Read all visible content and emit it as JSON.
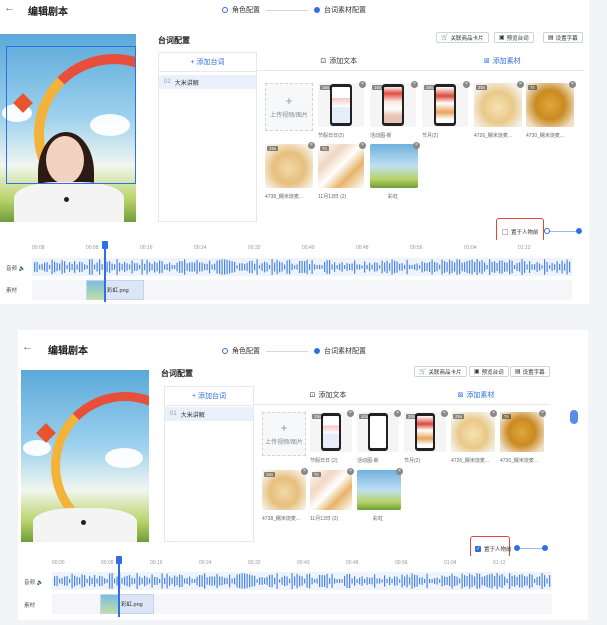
{
  "shot1": {
    "back_icon": "←",
    "title": "编辑剧本",
    "steps": [
      "角色配置",
      "台词素材配置"
    ],
    "panel_title": "台词配置",
    "toolbar": {
      "btn_card": "关联商品卡片",
      "btn_preview": "预览台词",
      "btn_subtitle": "设置字幕"
    },
    "sidebar": {
      "add_label": "+ 添加台词",
      "item_index": "01",
      "item_label": "大米讲解"
    },
    "tabs": {
      "text": "添加文本",
      "material": "添加素材"
    },
    "upload_label": "上传视频/图片",
    "assets_row1": [
      {
        "badge": "15s",
        "cap": "节假日日(2)"
      },
      {
        "badge": "10s",
        "cap": "活动图-新"
      },
      {
        "badge": "20s",
        "cap": "节月(2)"
      },
      {
        "badge": "25s",
        "cap": "4726_糯米烧麦..."
      },
      {
        "badge": "7s",
        "cap": "4730_糯米烧麦..."
      }
    ],
    "assets_row2": [
      {
        "badge": "15s",
        "cap": "4738_糯米烧麦..."
      },
      {
        "badge": "7s",
        "cap": "11月13日 (2)"
      },
      {
        "badge": "",
        "cap": "彩虹"
      }
    ],
    "checkbox_label": "置于人物前",
    "ticks": [
      "00:08",
      "00:08",
      "00:16",
      "00:24",
      "00:32",
      "00:40",
      "00:48",
      "00:56",
      "01:04",
      "01:12"
    ],
    "track_audio": "音频",
    "track_material": "素材",
    "clip_label": "彩虹.png"
  },
  "shot2": {
    "back_icon": "←",
    "title": "编辑剧本",
    "steps": [
      "角色配置",
      "台词素材配置"
    ],
    "panel_title": "台词配置",
    "toolbar": {
      "btn_card": "关联商品卡片",
      "btn_preview": "预览台词",
      "btn_subtitle": "设置字幕"
    },
    "sidebar": {
      "add_label": "+ 添加台词",
      "item_index": "01",
      "item_label": "大米讲解"
    },
    "tabs": {
      "text": "添加文本",
      "material": "添加素材"
    },
    "upload_label": "上传视频/图片",
    "assets_row1": [
      {
        "badge": "15s",
        "cap": "节假日日 (2)"
      },
      {
        "badge": "10s",
        "cap": "活动图-新"
      },
      {
        "badge": "20s",
        "cap": "节月(2)"
      },
      {
        "badge": "25s",
        "cap": "4726_糯米烧麦..."
      },
      {
        "badge": "7s",
        "cap": "4730_糯米烧麦..."
      }
    ],
    "assets_row2": [
      {
        "badge": "15s",
        "cap": "4738_糯米烧麦..."
      },
      {
        "badge": "7s",
        "cap": "11月13日 (2)"
      },
      {
        "badge": "",
        "cap": "彩虹"
      }
    ],
    "checkbox_label": "置于人物前",
    "ticks": [
      "00:00",
      "00:08",
      "00:16",
      "00:24",
      "00:32",
      "00:40",
      "00:48",
      "00:56",
      "01:04",
      "01:12"
    ],
    "track_audio": "音频",
    "track_material": "素材",
    "clip_label": "彩虹.png"
  },
  "colors": {
    "accent": "#2f6fe4",
    "highlight_box": "#e0473a"
  }
}
